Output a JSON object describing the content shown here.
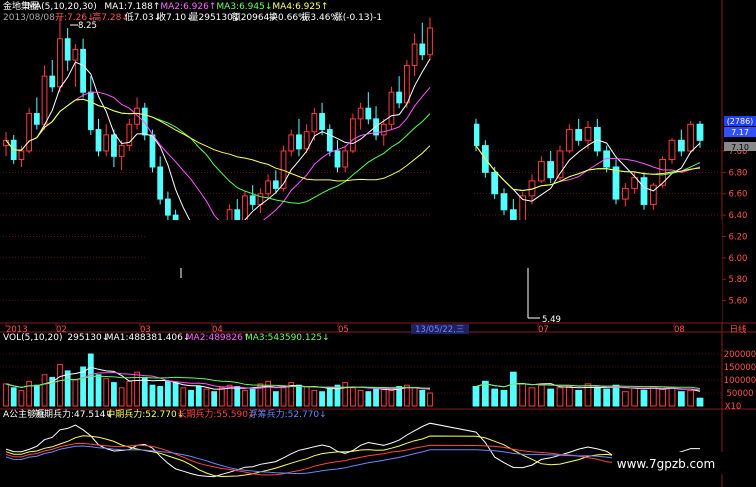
{
  "header": {
    "row1": [
      {
        "text": "金地集团",
        "color": "#ffffff"
      },
      {
        "text": "MA(5,10,20,30)",
        "color": "#ffffff"
      },
      {
        "text": "MA1:7.188↑",
        "color": "#ffffff"
      },
      {
        "text": "MA2:6.926↑",
        "color": "#ff66ff"
      },
      {
        "text": "MA3:6.945↓",
        "color": "#66ff66"
      },
      {
        "text": "MA4:6.925↑",
        "color": "#ffff66"
      }
    ],
    "row2": [
      {
        "text": "2013/08/08",
        "color": "#aaaaaa"
      },
      {
        "text": "开:7.26↓",
        "color": "#ff5555"
      },
      {
        "text": "高7.28↓",
        "color": "#ff5555"
      },
      {
        "text": "低7.03↓",
        "color": "#ffffff"
      },
      {
        "text": "收7.10↓",
        "color": "#ffffff"
      },
      {
        "text": "量295130↓",
        "color": "#ffffff"
      },
      {
        "text": "额20964↓",
        "color": "#ffffff"
      },
      {
        "text": "换0.66%",
        "color": "#ffffff"
      },
      {
        "text": "振3.46%",
        "color": "#ffffff"
      },
      {
        "text": "涨(-0.13)-1",
        "color": "#ffffff"
      }
    ]
  },
  "price_panel": {
    "high_marker": "8.25",
    "low_marker": "5.49",
    "badge_value": "(2786)",
    "current_price": "7.17",
    "last_price": "7.10"
  },
  "x_axis": {
    "labels": [
      "2013",
      "02",
      "03",
      "04",
      "05",
      "13/05/22,三",
      "07",
      "08"
    ],
    "corner": "日线"
  },
  "volume_panel": {
    "header": [
      {
        "text": "VOL(5,10,20)",
        "color": "#ffffff"
      },
      {
        "text": "295130↓",
        "color": "#ffffff"
      },
      {
        "text": "MA1:488381.406↓",
        "color": "#ffffff"
      },
      {
        "text": "MA2:489826↑",
        "color": "#ff66ff"
      },
      {
        "text": "MA3:543590.125↓",
        "color": "#66ff66"
      }
    ],
    "y_unit": "X10"
  },
  "indicator_panel": {
    "header": [
      {
        "text": "A公主够兵",
        "color": "#ffffff"
      },
      {
        "text": "短期兵力:47.514↓",
        "color": "#ffffff"
      },
      {
        "text": "中期兵力:52.770↓",
        "color": "#ffff66"
      },
      {
        "text": "长期兵力:55.590↓",
        "color": "#ff4444"
      },
      {
        "text": "浮筹兵力:52.770↓",
        "color": "#6688ff"
      }
    ]
  },
  "watermark": "www.7gpzb.com",
  "colors": {
    "up": "#ff3b3b",
    "down": "#54ffff",
    "ma1": "#ffffff",
    "ma2": "#ff55ff",
    "ma3": "#55ff55",
    "ma4": "#ffff55",
    "grid": "#8a1a1a"
  },
  "chart_data": [
    {
      "type": "candlestick",
      "title": "金地集团",
      "period": "日线",
      "ylim": [
        5.4,
        8.3
      ],
      "y_ticks": [
        5.6,
        5.8,
        6.0,
        6.2,
        6.4,
        6.6,
        6.8,
        7.0
      ],
      "annotated_high": 8.25,
      "annotated_low": 5.49,
      "segments": [
        {
          "start": "2013-01",
          "ohlc": [
            [
              7.05,
              7.18,
              6.95,
              7.1
            ],
            [
              7.1,
              7.15,
              6.88,
              6.92
            ],
            [
              6.92,
              7.05,
              6.85,
              7.0
            ],
            [
              7.0,
              7.4,
              6.98,
              7.35
            ],
            [
              7.35,
              7.5,
              7.2,
              7.25
            ],
            [
              7.25,
              7.8,
              7.2,
              7.7
            ],
            [
              7.7,
              7.85,
              7.55,
              7.6
            ],
            [
              7.6,
              8.25,
              7.55,
              8.05
            ],
            [
              8.05,
              8.15,
              7.75,
              7.85
            ],
            [
              7.85,
              8.0,
              7.6,
              7.95
            ],
            [
              7.95,
              8.05,
              7.5,
              7.55
            ],
            [
              7.55,
              7.7,
              7.15,
              7.2
            ],
            [
              7.2,
              7.3,
              6.95,
              7.0
            ],
            [
              7.0,
              7.25,
              6.95,
              7.15
            ],
            [
              7.15,
              7.2,
              6.85,
              6.95
            ],
            [
              6.95,
              7.1,
              6.82,
              7.05
            ],
            [
              7.05,
              7.3,
              7.0,
              7.25
            ],
            [
              7.25,
              7.5,
              7.2,
              7.4
            ],
            [
              7.4,
              7.45,
              7.1,
              7.15
            ],
            [
              7.15,
              7.2,
              6.8,
              6.85
            ],
            [
              6.85,
              6.95,
              6.5,
              6.55
            ],
            [
              6.55,
              6.62,
              6.35,
              6.4
            ],
            [
              6.4,
              6.45,
              6.2,
              6.25
            ],
            [
              6.25,
              6.35,
              6.15,
              6.3
            ],
            [
              6.3,
              6.32,
              6.1,
              6.15
            ],
            [
              6.15,
              6.2,
              5.98,
              6.05
            ],
            [
              6.05,
              6.25,
              6.0,
              6.22
            ],
            [
              6.22,
              6.28,
              6.05,
              6.1
            ],
            [
              6.1,
              6.35,
              6.08,
              6.3
            ],
            [
              6.3,
              6.5,
              6.25,
              6.45
            ],
            [
              6.45,
              6.55,
              6.3,
              6.35
            ],
            [
              6.35,
              6.62,
              6.32,
              6.58
            ],
            [
              6.58,
              6.68,
              6.45,
              6.5
            ],
            [
              6.5,
              6.65,
              6.42,
              6.6
            ],
            [
              6.6,
              6.78,
              6.55,
              6.72
            ],
            [
              6.72,
              6.82,
              6.6,
              6.65
            ],
            [
              6.65,
              7.05,
              6.62,
              7.0
            ],
            [
              7.0,
              7.2,
              6.95,
              7.15
            ],
            [
              7.15,
              7.3,
              6.95,
              7.02
            ],
            [
              7.02,
              7.25,
              6.98,
              7.18
            ],
            [
              7.18,
              7.4,
              7.1,
              7.35
            ],
            [
              7.35,
              7.45,
              7.15,
              7.2
            ],
            [
              7.2,
              7.25,
              6.95,
              7.0
            ],
            [
              7.0,
              7.1,
              6.8,
              6.85
            ],
            [
              6.85,
              7.05,
              6.8,
              7.0
            ],
            [
              7.0,
              7.35,
              6.98,
              7.3
            ],
            [
              7.3,
              7.45,
              7.2,
              7.4
            ],
            [
              7.4,
              7.55,
              7.25,
              7.3
            ],
            [
              7.3,
              7.42,
              7.1,
              7.15
            ],
            [
              7.15,
              7.3,
              7.05,
              7.25
            ],
            [
              7.25,
              7.6,
              7.2,
              7.55
            ],
            [
              7.55,
              7.7,
              7.4,
              7.45
            ],
            [
              7.45,
              7.85,
              7.4,
              7.8
            ],
            [
              7.8,
              8.1,
              7.7,
              8.0
            ],
            [
              8.0,
              8.2,
              7.85,
              7.9
            ],
            [
              7.9,
              8.25,
              7.85,
              8.15
            ]
          ]
        },
        {
          "start": "2013-06",
          "ohlc": [
            [
              7.25,
              7.3,
              7.0,
              7.05
            ],
            [
              7.05,
              7.1,
              6.75,
              6.8
            ],
            [
              6.8,
              6.85,
              6.55,
              6.6
            ],
            [
              6.6,
              6.65,
              6.4,
              6.45
            ],
            [
              6.45,
              6.55,
              5.49,
              6.3
            ],
            [
              6.3,
              6.62,
              6.25,
              6.58
            ],
            [
              6.58,
              6.78,
              6.5,
              6.72
            ],
            [
              6.72,
              6.95,
              6.7,
              6.9
            ],
            [
              6.9,
              7.0,
              6.7,
              6.75
            ],
            [
              6.75,
              7.05,
              6.72,
              7.0
            ],
            [
              7.0,
              7.25,
              6.98,
              7.2
            ],
            [
              7.2,
              7.3,
              7.05,
              7.1
            ],
            [
              7.1,
              7.28,
              7.02,
              7.22
            ],
            [
              7.22,
              7.3,
              6.95,
              7.0
            ],
            [
              7.0,
              7.05,
              6.8,
              6.85
            ],
            [
              6.85,
              6.92,
              6.5,
              6.55
            ],
            [
              6.55,
              6.7,
              6.48,
              6.65
            ],
            [
              6.65,
              6.8,
              6.6,
              6.75
            ],
            [
              6.75,
              6.8,
              6.45,
              6.5
            ],
            [
              6.5,
              6.7,
              6.45,
              6.68
            ],
            [
              6.68,
              6.95,
              6.65,
              6.92
            ],
            [
              6.92,
              7.12,
              6.88,
              7.1
            ],
            [
              7.1,
              7.2,
              6.95,
              7.0
            ],
            [
              7.0,
              7.28,
              6.98,
              7.25
            ],
            [
              7.25,
              7.28,
              7.03,
              7.1
            ]
          ]
        }
      ],
      "series": [
        {
          "name": "MA1",
          "param": 5
        },
        {
          "name": "MA2",
          "param": 10
        },
        {
          "name": "MA3",
          "param": 20
        },
        {
          "name": "MA4",
          "param": 30
        }
      ]
    },
    {
      "type": "bar",
      "title": "VOL(5,10,20)",
      "unit": "X10",
      "ylim": [
        0,
        250000
      ],
      "y_ticks": [
        0,
        50000,
        100000,
        150000,
        200000
      ],
      "segments": [
        {
          "values": [
            85,
            70,
            60,
            95,
            80,
            120,
            110,
            160,
            135,
            100,
            150,
            200,
            120,
            105,
            90,
            70,
            95,
            130,
            110,
            80,
            75,
            95,
            90,
            70,
            60,
            75,
            65,
            55,
            70,
            80,
            75,
            60,
            65,
            85,
            95,
            55,
            70,
            90,
            80,
            75,
            60,
            55,
            65,
            80,
            90,
            70,
            60,
            55,
            65,
            70,
            60,
            75,
            80,
            70,
            60,
            50
          ]
        },
        {
          "values": [
            75,
            95,
            65,
            60,
            130,
            85,
            70,
            80,
            65,
            70,
            75,
            60,
            85,
            70,
            65,
            80,
            55,
            70,
            60,
            75,
            65,
            70,
            55,
            60,
            30
          ]
        }
      ]
    },
    {
      "type": "line",
      "title": "A公主够兵",
      "series": [
        {
          "name": "短期兵力",
          "final": 47.514
        },
        {
          "name": "中期兵力",
          "final": 52.77
        },
        {
          "name": "长期兵力",
          "final": 55.59
        },
        {
          "name": "浮筹兵力",
          "final": 52.77
        }
      ]
    }
  ]
}
